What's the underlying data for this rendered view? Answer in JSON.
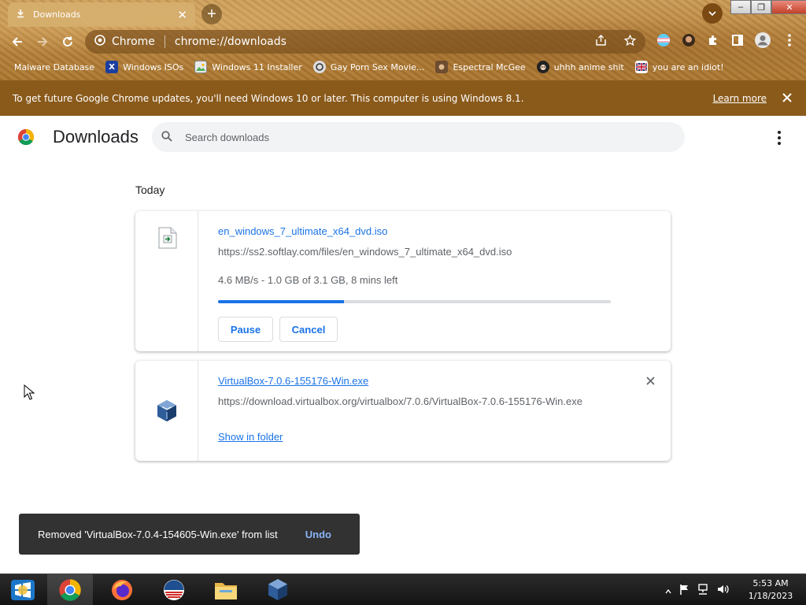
{
  "browser": {
    "tab_title": "Downloads",
    "tab_close": "✕",
    "new_tab": "+",
    "window_controls": {
      "minimize": "–",
      "restore": "❐",
      "close": "✕"
    }
  },
  "toolbar": {
    "site_label": "Chrome",
    "url": "chrome://downloads"
  },
  "bookmarks": [
    {
      "label": "Malware Database",
      "icon": "none"
    },
    {
      "label": "Windows ISOs",
      "icon": "x-logo-icon"
    },
    {
      "label": "Windows 11 Installer",
      "icon": "image-icon"
    },
    {
      "label": "Gay Porn Sex Movie...",
      "icon": "site-icon"
    },
    {
      "label": "Espectral McGee",
      "icon": "site-icon"
    },
    {
      "label": "uhhh anime shit",
      "icon": "anime-icon"
    },
    {
      "label": "you are an idiot!",
      "icon": "flag-icon"
    }
  ],
  "infobar": {
    "message": "To get future Google Chrome updates, you'll need Windows 10 or later. This computer is using Windows 8.1.",
    "learn_more": "Learn more"
  },
  "downloads_page": {
    "title": "Downloads",
    "search_placeholder": "Search downloads",
    "section": "Today",
    "items": [
      {
        "filename": "en_windows_7_ultimate_x64_dvd.iso",
        "url": "https://ss2.softlay.com/files/en_windows_7_ultimate_x64_dvd.iso",
        "status": "4.6 MB/s - 1.0 GB of 3.1 GB, 8 mins left",
        "progress_fraction": 0.32,
        "pause_label": "Pause",
        "cancel_label": "Cancel"
      },
      {
        "filename": "VirtualBox-7.0.6-155176-Win.exe",
        "url": "https://download.virtualbox.org/virtualbox/7.0.6/VirtualBox-7.0.6-155176-Win.exe",
        "show_in_folder": "Show in folder"
      }
    ]
  },
  "toast": {
    "message": "Removed 'VirtualBox-7.0.4-154605-Win.exe' from list",
    "undo": "Undo"
  },
  "taskbar": {
    "time": "5:53 AM",
    "date": "1/18/2023"
  },
  "colors": {
    "accent": "#1a73e8",
    "infobar": "#8a5a1b",
    "toast_bg": "#323232",
    "undo": "#8ab4f8"
  }
}
